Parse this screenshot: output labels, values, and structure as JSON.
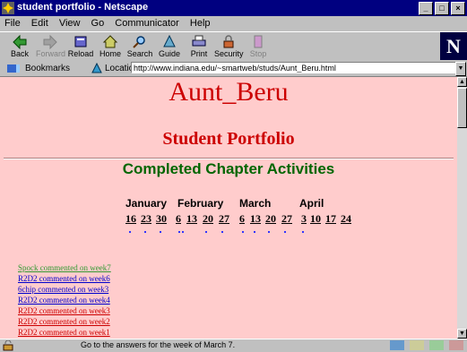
{
  "window": {
    "title": "student portfolio - Netscape"
  },
  "menu": [
    "File",
    "Edit",
    "View",
    "Go",
    "Communicator",
    "Help"
  ],
  "toolbar": {
    "back": "Back",
    "forward": "Forward",
    "reload": "Reload",
    "home": "Home",
    "search": "Search",
    "guide": "Guide",
    "print": "Print",
    "security": "Security",
    "stop": "Stop"
  },
  "location": {
    "bookmarks_label": "Bookmarks",
    "location_label": "Location:",
    "url": "http://www.indiana.edu/~smartweb/studs/Aunt_Beru.html"
  },
  "page": {
    "title": "Aunt_Beru",
    "subtitle": "Student Portfolio",
    "section": "Completed Chapter Activities"
  },
  "months": [
    {
      "name": "January",
      "days": [
        "16",
        "23",
        "30"
      ]
    },
    {
      "name": "February",
      "days": [
        "6",
        "13",
        "20",
        "27"
      ]
    },
    {
      "name": "March",
      "days": [
        "6",
        "13",
        "20",
        "27"
      ]
    },
    {
      "name": "April",
      "days": [
        "3",
        "10",
        "17",
        "24"
      ]
    }
  ],
  "comments": [
    {
      "text": "Spock commented on week7",
      "color": "#339933"
    },
    {
      "text": "R2D2 commented on week6",
      "color": "#0000cc"
    },
    {
      "text": "6chip commented on week3",
      "color": "#0000cc"
    },
    {
      "text": "R2D2 commented on week4",
      "color": "#0000cc"
    },
    {
      "text": "R2D2 commented on week3",
      "color": "#cc0000"
    },
    {
      "text": "R2D2 commented on week2",
      "color": "#cc0000"
    },
    {
      "text": "R2D2 commented on week1",
      "color": "#cc0000"
    }
  ],
  "status": {
    "text": "Go to the answers for the week of March 7."
  }
}
